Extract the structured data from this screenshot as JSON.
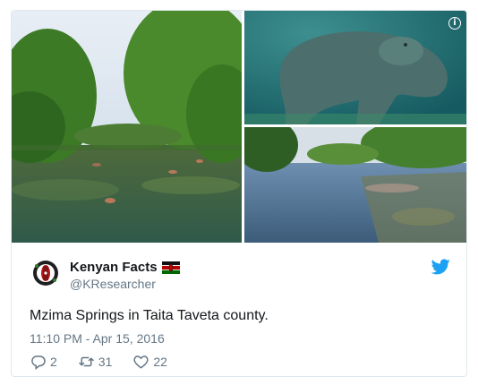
{
  "media": {
    "photos": [
      {
        "subject": "river-with-trees"
      },
      {
        "subject": "hippo-underwater"
      },
      {
        "subject": "spring-pool"
      }
    ],
    "info_icon": "info-icon",
    "info_glyph": "i"
  },
  "user": {
    "display_name": "Kenyan Facts",
    "handle": "@KResearcher",
    "badge_icon": "kenya-flag-icon"
  },
  "tweet": {
    "text": "Mzima Springs in Taita Taveta county.",
    "timestamp": "11:10 PM - Apr 15, 2016"
  },
  "actions": {
    "reply_count": "2",
    "retweet_count": "31",
    "like_count": "22"
  },
  "colors": {
    "brand_blue": "#1da1f2",
    "secondary_text": "#657786",
    "border": "#e1e8ed"
  }
}
